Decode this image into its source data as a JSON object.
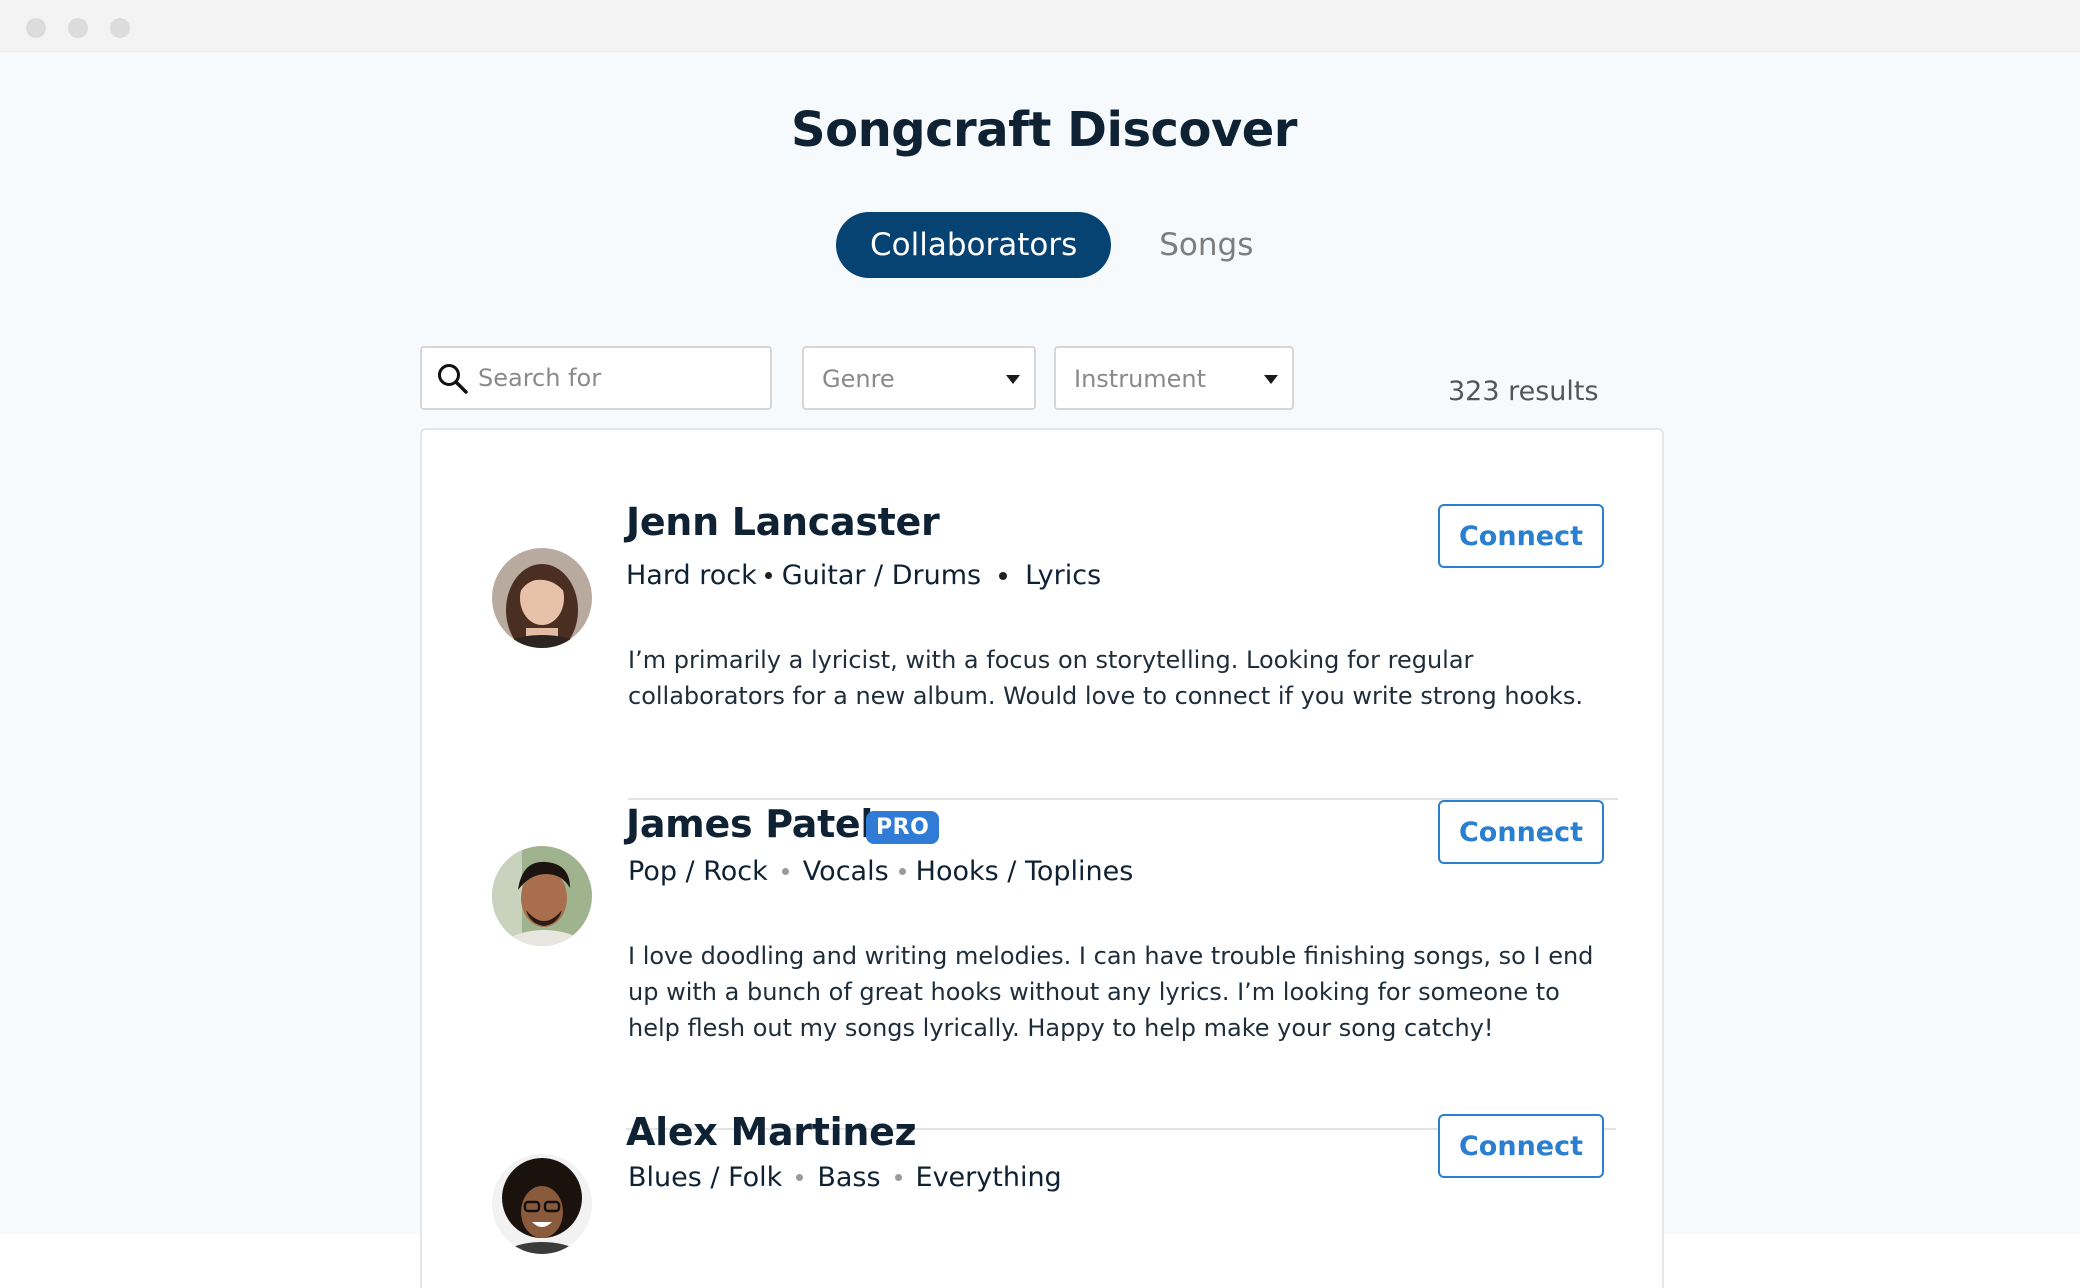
{
  "app": {
    "title": "Songcraft Discover"
  },
  "tabs": {
    "active_label": "Collaborators",
    "other_label": "Songs"
  },
  "search": {
    "placeholder": "Search for",
    "value": ""
  },
  "filters": {
    "genre_label": "Genre",
    "instrument_label": "Instrument"
  },
  "results": {
    "count_text": "323 results"
  },
  "colors": {
    "primary": "#064272",
    "accent": "#2a7fd0",
    "badge": "#2f7bd6"
  },
  "collaborators": [
    {
      "name": "Jenn Lancaster",
      "badge": "",
      "tags": [
        "Hard rock",
        "Guitar / Drums",
        "Lyrics"
      ],
      "bio_lines": [
        "I’m primarily a lyricist, with a focus on storytelling. Looking for regular",
        "collaborators for a new album. Would love to connect if you write strong hooks."
      ],
      "action": "Connect"
    },
    {
      "name": "James Patel",
      "badge": "PRO",
      "tags": [
        "Pop / Rock",
        "Vocals",
        "Hooks / Toplines"
      ],
      "bio_lines": [
        "I love doodling and writing melodies. I can have trouble finishing songs, so I end",
        "up with a bunch of great hooks without any lyrics. I’m looking for someone to",
        "help flesh out my songs lyrically. Happy to help make your song catchy!"
      ],
      "action": "Connect"
    },
    {
      "name": "Alex Martinez",
      "badge": "",
      "tags": [
        "Blues / Folk",
        "Bass",
        "Everything"
      ],
      "bio_lines": [],
      "action": "Connect"
    }
  ]
}
